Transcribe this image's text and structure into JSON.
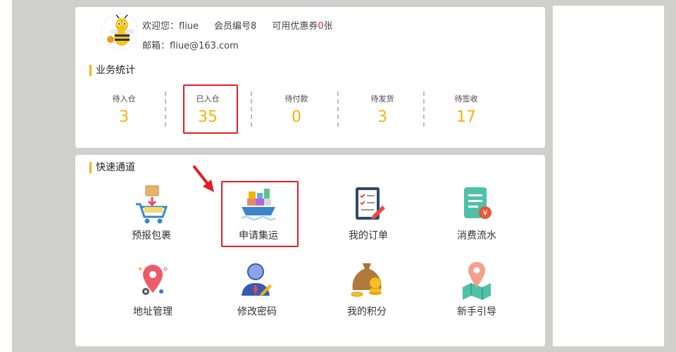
{
  "user": {
    "welcome": "欢迎您：fliue",
    "member_no": "会员编号8",
    "coupon_prefix": "可用优惠券",
    "coupon_count": "0",
    "coupon_suffix": "张",
    "email_label": "邮箱：",
    "email": "fliue@163.com"
  },
  "stats_section": {
    "title": "业务统计",
    "items": [
      {
        "label": "待入仓",
        "value": "3"
      },
      {
        "label": "已入仓",
        "value": "35"
      },
      {
        "label": "待付款",
        "value": "0"
      },
      {
        "label": "待发货",
        "value": "3"
      },
      {
        "label": "待签收",
        "value": "17"
      }
    ]
  },
  "quick_section": {
    "title": "快速通道",
    "tiles": [
      {
        "label": "预报包裹",
        "icon": "cart-package-icon"
      },
      {
        "label": "申请集运",
        "icon": "cargo-ship-icon"
      },
      {
        "label": "我的订单",
        "icon": "clipboard-order-icon"
      },
      {
        "label": "消费流水",
        "icon": "receipt-yen-icon"
      },
      {
        "label": "地址管理",
        "icon": "location-pin-gear-icon"
      },
      {
        "label": "修改密码",
        "icon": "user-pencil-icon"
      },
      {
        "label": "我的积分",
        "icon": "money-bag-coins-icon"
      },
      {
        "label": "新手引导",
        "icon": "map-pin-guide-icon"
      }
    ]
  },
  "colors": {
    "accent": "#f2b40d",
    "highlight": "#e31e24",
    "background": "#cfcfcc"
  }
}
